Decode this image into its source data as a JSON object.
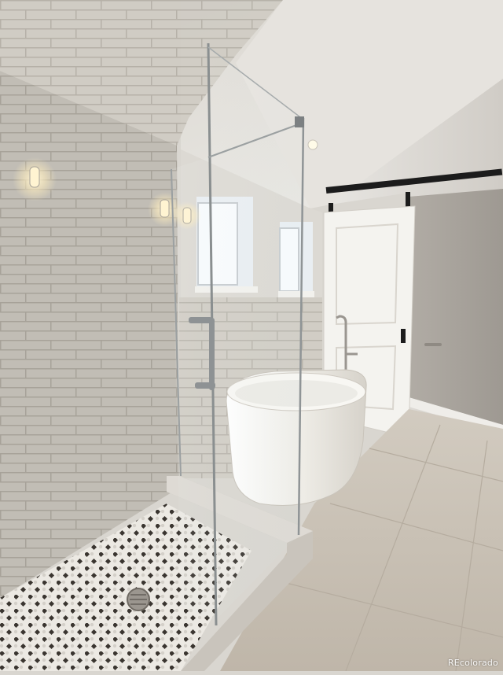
{
  "photo": {
    "subject": "bathroom",
    "colors": {
      "ceiling": "#e4e1dc",
      "wall_gray": "#a9a49c",
      "subway_tile": "#cfcbc3",
      "floor_tile": "#cdc5b9",
      "barn_door": "#f4f3ef",
      "tub": "#f1efe9",
      "hardware": "#1c1c1c",
      "mosaic_dot": "#3a3530"
    },
    "icons": [
      "recessed-light-icon",
      "wall-sconce-icon",
      "floor-drain-icon",
      "barn-door-rail-icon"
    ]
  },
  "watermark": {
    "text": "REcolorado"
  }
}
